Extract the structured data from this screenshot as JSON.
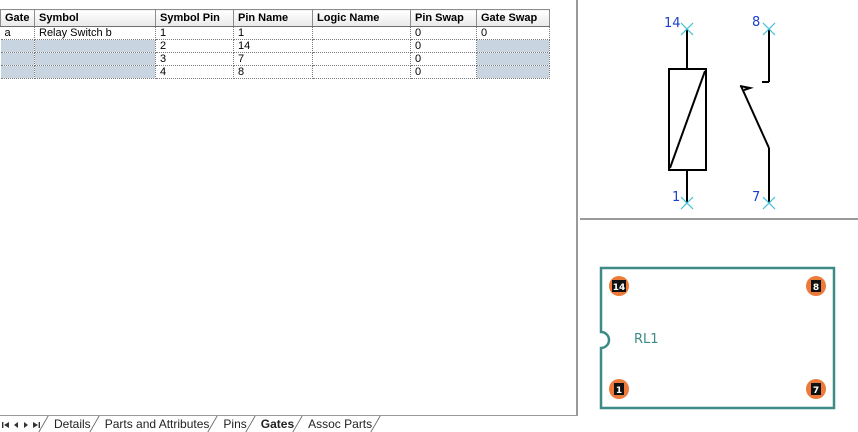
{
  "grid": {
    "columns": [
      "Gate",
      "Symbol",
      "Symbol Pin",
      "Pin Name",
      "Logic Name",
      "Pin Swap",
      "Gate Swap"
    ],
    "rows": [
      {
        "gate": "a",
        "symbol": "Relay Switch b",
        "symbol_pin": "1",
        "pin_name": "1",
        "logic_name": "",
        "pin_swap": "0",
        "gate_swap": "0"
      },
      {
        "gate": "",
        "symbol": "",
        "symbol_pin": "2",
        "pin_name": "14",
        "logic_name": "",
        "pin_swap": "0",
        "gate_swap": ""
      },
      {
        "gate": "",
        "symbol": "",
        "symbol_pin": "3",
        "pin_name": "7",
        "logic_name": "",
        "pin_swap": "0",
        "gate_swap": ""
      },
      {
        "gate": "",
        "symbol": "",
        "symbol_pin": "4",
        "pin_name": "8",
        "logic_name": "",
        "pin_swap": "0",
        "gate_swap": ""
      }
    ]
  },
  "tabs": [
    "Details",
    "Parts and Attributes",
    "Pins",
    "Gates",
    "Assoc Parts"
  ],
  "active_tab": "Gates",
  "nav_icons": [
    "first-icon",
    "prev-icon",
    "next-icon",
    "last-icon"
  ],
  "symbol": {
    "pin_labels": {
      "top_left": "14",
      "top_right": "8",
      "bottom_left": "1",
      "bottom_right": "7"
    },
    "colors": {
      "pin_marker": "#3cc0d8",
      "pin_label": "#1a3fd0",
      "body": "#000000"
    }
  },
  "footprint": {
    "designator": "RL1",
    "pads": {
      "top_left": "14",
      "top_right": "8",
      "bottom_left": "1",
      "bottom_right": "7"
    },
    "colors": {
      "outline": "#3d8a86",
      "pad": "#ee7a3a",
      "pad_label_bg": "#111111",
      "designator": "#3d8a86"
    }
  },
  "colors": {
    "selected_row": "#c8d4e0"
  }
}
